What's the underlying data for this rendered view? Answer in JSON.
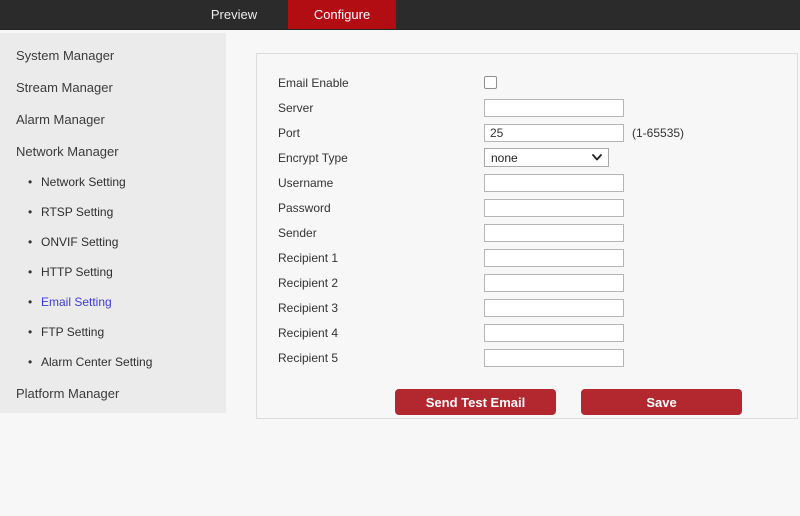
{
  "header": {
    "tabs": [
      {
        "label": "Preview",
        "active": false
      },
      {
        "label": "Configure",
        "active": true
      }
    ]
  },
  "sidebar": {
    "items": [
      {
        "label": "System Manager",
        "type": "group",
        "active": false
      },
      {
        "label": "Stream Manager",
        "type": "group",
        "active": false
      },
      {
        "label": "Alarm Manager",
        "type": "group",
        "active": false
      },
      {
        "label": "Network Manager",
        "type": "group",
        "active": false
      },
      {
        "label": "Network Setting",
        "type": "sub",
        "active": false
      },
      {
        "label": "RTSP Setting",
        "type": "sub",
        "active": false
      },
      {
        "label": "ONVIF Setting",
        "type": "sub",
        "active": false
      },
      {
        "label": "HTTP Setting",
        "type": "sub",
        "active": false
      },
      {
        "label": "Email Setting",
        "type": "sub",
        "active": true
      },
      {
        "label": "FTP Setting",
        "type": "sub",
        "active": false
      },
      {
        "label": "Alarm Center Setting",
        "type": "sub",
        "active": false
      },
      {
        "label": "Platform Manager",
        "type": "group",
        "active": false
      }
    ],
    "bullet": "•"
  },
  "form": {
    "rows": [
      {
        "label": "Email Enable",
        "control": "checkbox",
        "checked": false
      },
      {
        "label": "Server",
        "control": "input",
        "value": ""
      },
      {
        "label": "Port",
        "control": "input",
        "value": "25",
        "hint": "(1-65535)"
      },
      {
        "label": "Encrypt Type",
        "control": "select",
        "value": "none"
      },
      {
        "label": "Username",
        "control": "input",
        "value": ""
      },
      {
        "label": "Password",
        "control": "input",
        "value": ""
      },
      {
        "label": "Sender",
        "control": "input",
        "value": ""
      },
      {
        "label": "Recipient 1",
        "control": "input",
        "value": ""
      },
      {
        "label": "Recipient 2",
        "control": "input",
        "value": ""
      },
      {
        "label": "Recipient 3",
        "control": "input",
        "value": ""
      },
      {
        "label": "Recipient 4",
        "control": "input",
        "value": ""
      },
      {
        "label": "Recipient 5",
        "control": "input",
        "value": ""
      }
    ],
    "buttons": {
      "send_test": "Send Test Email",
      "save": "Save"
    }
  },
  "colors": {
    "topbar_bg": "#2b2b2b",
    "accent_red": "#b30d14",
    "button_red": "#b2282e",
    "active_link_blue": "#3c3ccd",
    "sidebar_bg": "#ebebeb",
    "page_bg": "#f7f7f7"
  }
}
